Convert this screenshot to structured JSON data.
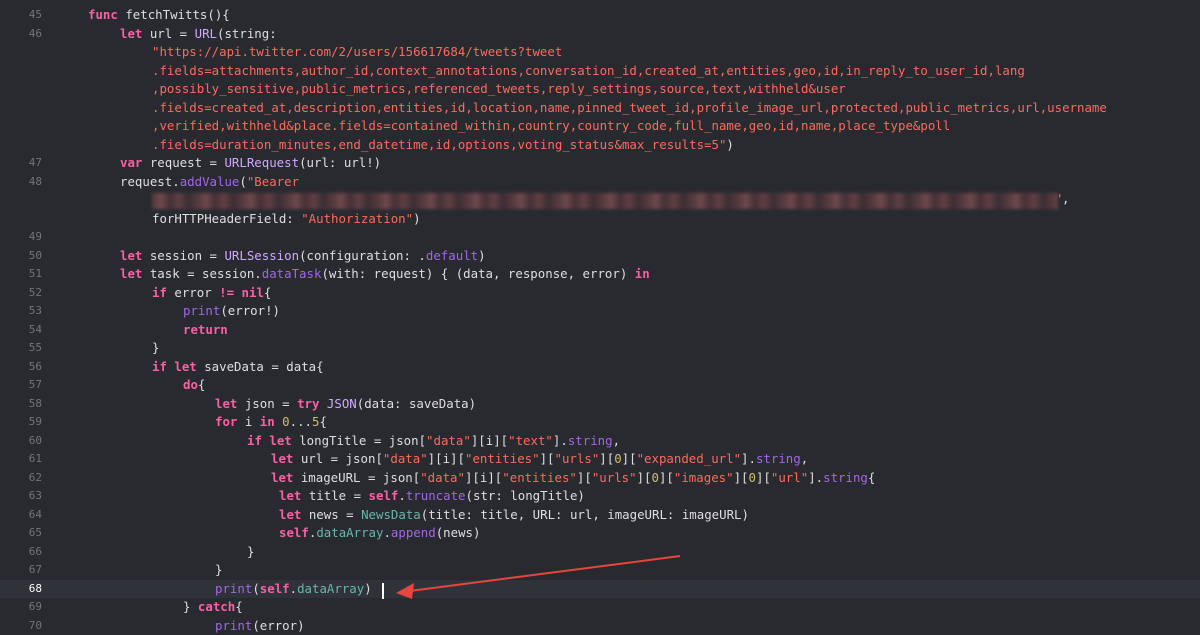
{
  "editor": {
    "lines": [
      {
        "n": "45",
        "tokens": [
          [
            "kw",
            "func "
          ],
          [
            "pl",
            "fetchTwitts(){"
          ]
        ]
      },
      {
        "n": "46",
        "tokens": [
          [
            "kw",
            "let "
          ],
          [
            "pl",
            "url = "
          ],
          [
            "ty",
            "URL"
          ],
          [
            "pl",
            "(string:"
          ]
        ]
      },
      {
        "n": "",
        "tokens": [
          [
            "str",
            "\"https://api.twitter.com/2/users/156617684/tweets?tweet"
          ]
        ]
      },
      {
        "n": "",
        "tokens": [
          [
            "str",
            ".fields=attachments,author_id,context_annotations,conversation_id,created_at,entities,geo,id,in_reply_to_user_id,lang"
          ]
        ]
      },
      {
        "n": "",
        "tokens": [
          [
            "str",
            ",possibly_sensitive,public_metrics,referenced_tweets,reply_settings,source,text,withheld&user"
          ]
        ]
      },
      {
        "n": "",
        "tokens": [
          [
            "str",
            ".fields=created_at,description,entities,id,location,name,pinned_tweet_id,profile_image_url,protected,public_metrics,url,username"
          ]
        ]
      },
      {
        "n": "",
        "tokens": [
          [
            "str",
            ",verified,withheld&place.fields=contained_within,country,country_code,full_name,geo,id,name,place_type&poll"
          ]
        ]
      },
      {
        "n": "",
        "tokens": [
          [
            "str",
            ".fields=duration_minutes,end_datetime,id,options,voting_status&max_results=5\""
          ],
          [
            "pl",
            ")"
          ]
        ]
      },
      {
        "n": "47",
        "tokens": [
          [
            "kw",
            "var "
          ],
          [
            "pl",
            "request = "
          ],
          [
            "ty",
            "URLRequest"
          ],
          [
            "pl",
            "(url: url!)"
          ]
        ]
      },
      {
        "n": "48",
        "tokens": [
          [
            "pl",
            "request."
          ],
          [
            "mem",
            "addValue"
          ],
          [
            "pl",
            "("
          ],
          [
            "str",
            "\"Bearer"
          ]
        ]
      },
      {
        "n": "",
        "tokens": []
      },
      {
        "n": "",
        "tokens": [
          [
            "pl",
            "forHTTPHeaderField: "
          ],
          [
            "str",
            "\"Authorization\""
          ],
          [
            "pl",
            ")"
          ]
        ]
      },
      {
        "n": "49",
        "tokens": []
      },
      {
        "n": "50",
        "tokens": [
          [
            "kw",
            "let "
          ],
          [
            "pl",
            "session = "
          ],
          [
            "ty",
            "URLSession"
          ],
          [
            "pl",
            "(configuration: ."
          ],
          [
            "mem",
            "default"
          ],
          [
            "pl",
            ")"
          ]
        ]
      },
      {
        "n": "51",
        "tokens": [
          [
            "kw",
            "let "
          ],
          [
            "pl",
            "task = session."
          ],
          [
            "mem",
            "dataTask"
          ],
          [
            "pl",
            "(with: request) { (data, response, error) "
          ],
          [
            "kw",
            "in"
          ]
        ]
      },
      {
        "n": "52",
        "tokens": [
          [
            "kw",
            "if "
          ],
          [
            "pl",
            "error "
          ],
          [
            "kw",
            "!= nil"
          ],
          [
            "pl",
            "{"
          ]
        ]
      },
      {
        "n": "53",
        "tokens": [
          [
            "mem",
            "print"
          ],
          [
            "pl",
            "(error!)"
          ]
        ]
      },
      {
        "n": "54",
        "tokens": [
          [
            "kw",
            "return"
          ]
        ]
      },
      {
        "n": "55",
        "tokens": [
          [
            "pl",
            "}"
          ]
        ]
      },
      {
        "n": "56",
        "tokens": [
          [
            "kw",
            "if let "
          ],
          [
            "pl",
            "saveData = data{"
          ]
        ]
      },
      {
        "n": "57",
        "tokens": [
          [
            "kw",
            "do"
          ],
          [
            "pl",
            "{"
          ]
        ]
      },
      {
        "n": "58",
        "tokens": [
          [
            "kw",
            "let "
          ],
          [
            "pl",
            "json = "
          ],
          [
            "kw",
            "try "
          ],
          [
            "ty",
            "JSON"
          ],
          [
            "pl",
            "(data: saveData)"
          ]
        ]
      },
      {
        "n": "59",
        "tokens": [
          [
            "kw",
            "for "
          ],
          [
            "pl",
            "i "
          ],
          [
            "kw",
            "in "
          ],
          [
            "num",
            "0"
          ],
          [
            "pl",
            "..."
          ],
          [
            "num",
            "5"
          ],
          [
            "pl",
            "{"
          ]
        ]
      },
      {
        "n": "60",
        "tokens": [
          [
            "kw",
            "if let "
          ],
          [
            "pl",
            "longTitle = json["
          ],
          [
            "str",
            "\"data\""
          ],
          [
            "pl",
            "][i]["
          ],
          [
            "str",
            "\"text\""
          ],
          [
            "pl",
            "]."
          ],
          [
            "mem",
            "string"
          ],
          [
            "pl",
            ","
          ]
        ]
      },
      {
        "n": "61",
        "tokens": [
          [
            "kw",
            "let "
          ],
          [
            "pl",
            "url = json["
          ],
          [
            "str",
            "\"data\""
          ],
          [
            "pl",
            "][i]["
          ],
          [
            "str",
            "\"entities\""
          ],
          [
            "pl",
            "]["
          ],
          [
            "str",
            "\"urls\""
          ],
          [
            "pl",
            "]["
          ],
          [
            "num",
            "0"
          ],
          [
            "pl",
            "]["
          ],
          [
            "str",
            "\"expanded_url\""
          ],
          [
            "pl",
            "]."
          ],
          [
            "mem",
            "string"
          ],
          [
            "pl",
            ","
          ]
        ]
      },
      {
        "n": "62",
        "tokens": [
          [
            "kw",
            "let "
          ],
          [
            "pl",
            "imageURL = json["
          ],
          [
            "str",
            "\"data\""
          ],
          [
            "pl",
            "][i]["
          ],
          [
            "str",
            "\"entities\""
          ],
          [
            "pl",
            "]["
          ],
          [
            "str",
            "\"urls\""
          ],
          [
            "pl",
            "]["
          ],
          [
            "num",
            "0"
          ],
          [
            "pl",
            "]["
          ],
          [
            "str",
            "\"images\""
          ],
          [
            "pl",
            "]["
          ],
          [
            "num",
            "0"
          ],
          [
            "pl",
            "]["
          ],
          [
            "str",
            "\"url\""
          ],
          [
            "pl",
            "]."
          ],
          [
            "mem",
            "string"
          ],
          [
            "pl",
            "{"
          ]
        ]
      },
      {
        "n": "63",
        "tokens": [
          [
            "kw",
            "let "
          ],
          [
            "pl",
            "title = "
          ],
          [
            "kw",
            "self"
          ],
          [
            "pl",
            "."
          ],
          [
            "mem",
            "truncate"
          ],
          [
            "pl",
            "(str: longTitle)"
          ]
        ]
      },
      {
        "n": "64",
        "tokens": [
          [
            "kw",
            "let "
          ],
          [
            "pl",
            "news = "
          ],
          [
            "fn",
            "NewsData"
          ],
          [
            "pl",
            "(title: title, URL: url, imageURL: imageURL)"
          ]
        ]
      },
      {
        "n": "65",
        "tokens": [
          [
            "kw",
            "self"
          ],
          [
            "pl",
            "."
          ],
          [
            "fn",
            "dataArray"
          ],
          [
            "pl",
            "."
          ],
          [
            "mem",
            "append"
          ],
          [
            "pl",
            "(news)"
          ]
        ]
      },
      {
        "n": "66",
        "tokens": [
          [
            "pl",
            "}"
          ]
        ]
      },
      {
        "n": "67",
        "tokens": [
          [
            "pl",
            "}"
          ]
        ]
      },
      {
        "n": "68",
        "tokens": [
          [
            "mem",
            "print"
          ],
          [
            "pl",
            "("
          ],
          [
            "kw",
            "self"
          ],
          [
            "pl",
            "."
          ],
          [
            "fn",
            "dataArray"
          ],
          [
            "pl",
            ")"
          ]
        ]
      },
      {
        "n": "69",
        "tokens": [
          [
            "pl",
            "} "
          ],
          [
            "kw",
            "catch"
          ],
          [
            "pl",
            "{"
          ]
        ]
      },
      {
        "n": "70",
        "tokens": [
          [
            "mem",
            "print"
          ],
          [
            "pl",
            "(error)"
          ]
        ]
      }
    ],
    "current_line": "68",
    "redacted_token_tail": "'",
    "redacted_token_comma": ",",
    "annotation_arrow_color": "#e8453c"
  }
}
